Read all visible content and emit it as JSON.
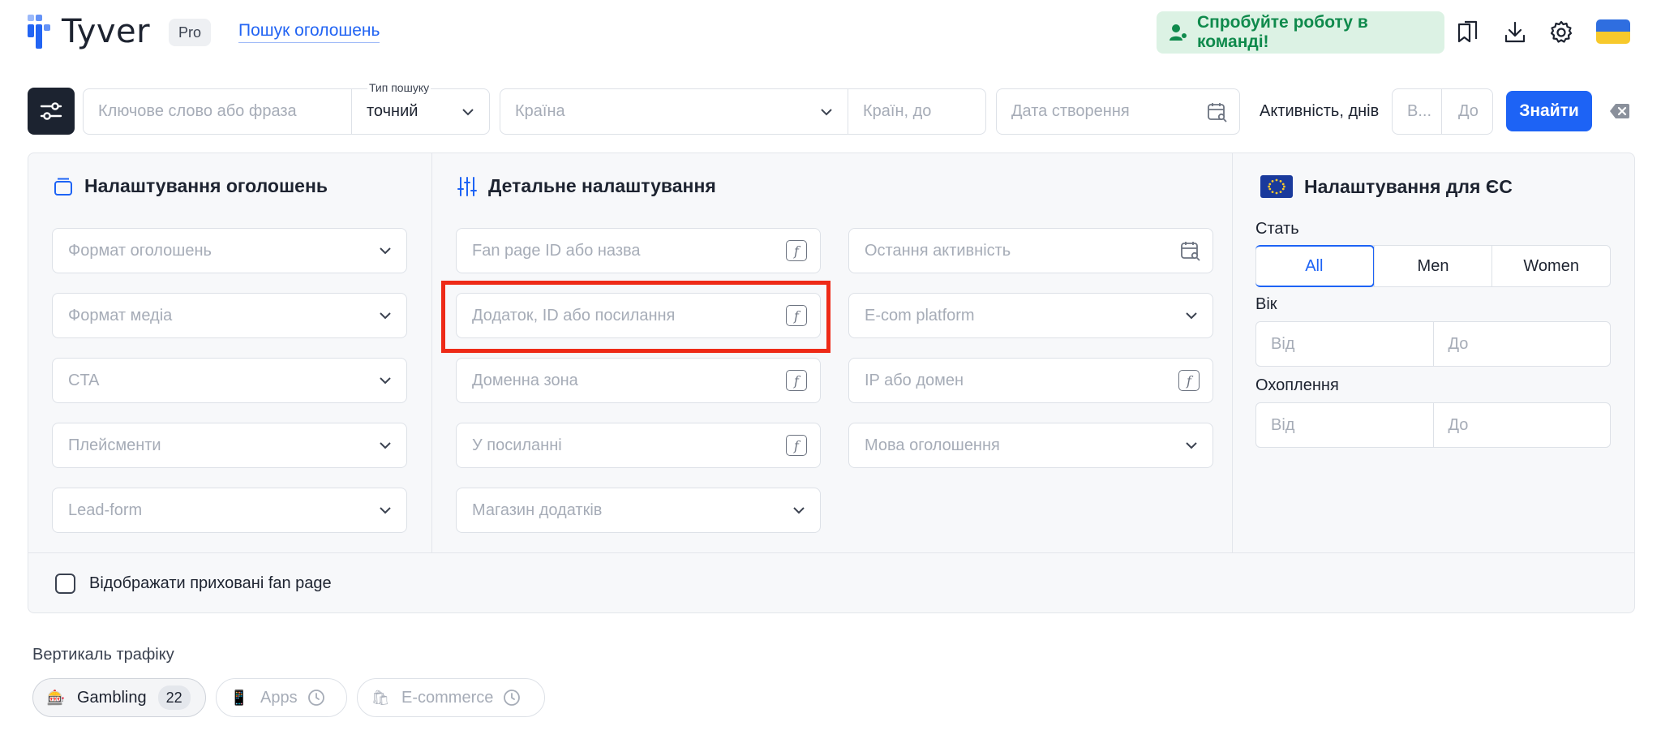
{
  "header": {
    "logo_text": "Tyver",
    "plan_badge": "Pro",
    "nav_link": "Пошук оголошень",
    "team_button": "Спробуйте роботу в команді!"
  },
  "search": {
    "keyword_placeholder": "Ключове слово або фраза",
    "search_type_label": "Тип пошуку",
    "search_type_value": "точний",
    "country_placeholder": "Країна",
    "countries_to_placeholder": "Країн, до",
    "created_date_placeholder": "Дата створення",
    "activity_label": "Активність, днів",
    "activity_from_placeholder": "В...",
    "activity_to_placeholder": "До",
    "find_button": "Знайти"
  },
  "ad_settings": {
    "title": "Налаштування оголошень",
    "fields": [
      "Формат оголошень",
      "Формат медіа",
      "CTA",
      "Плейсменти",
      "Lead-form"
    ]
  },
  "detailed": {
    "title": "Детальне налаштування",
    "col1": [
      "Fan page ID або назва",
      "Додаток, ID або посилання",
      "Доменна зона",
      "У посиланні",
      "Магазин додатків"
    ],
    "col2": [
      "Остання активність",
      "E-com platform",
      "IP або домен",
      "Мова оголошення"
    ]
  },
  "eu": {
    "title": "Налаштування для ЄС",
    "gender_label": "Стать",
    "gender_options": [
      "All",
      "Men",
      "Women"
    ],
    "age_label": "Вік",
    "age_from": "Від",
    "age_to": "До",
    "reach_label": "Охоплення",
    "reach_from": "Від",
    "reach_to": "До"
  },
  "hidden_fanpage_label": "Відображати приховані fan page",
  "verticals": {
    "title": "Вертикаль трафіку",
    "items": [
      {
        "icon": "🎰",
        "label": "Gambling",
        "count": "22"
      },
      {
        "icon": "📱",
        "label": "Apps"
      },
      {
        "icon": "🛍",
        "label": "E-commerce"
      }
    ]
  },
  "colors": {
    "accent": "#1d63f5",
    "success": "#0f8a4c",
    "highlight": "#ee2a17"
  }
}
